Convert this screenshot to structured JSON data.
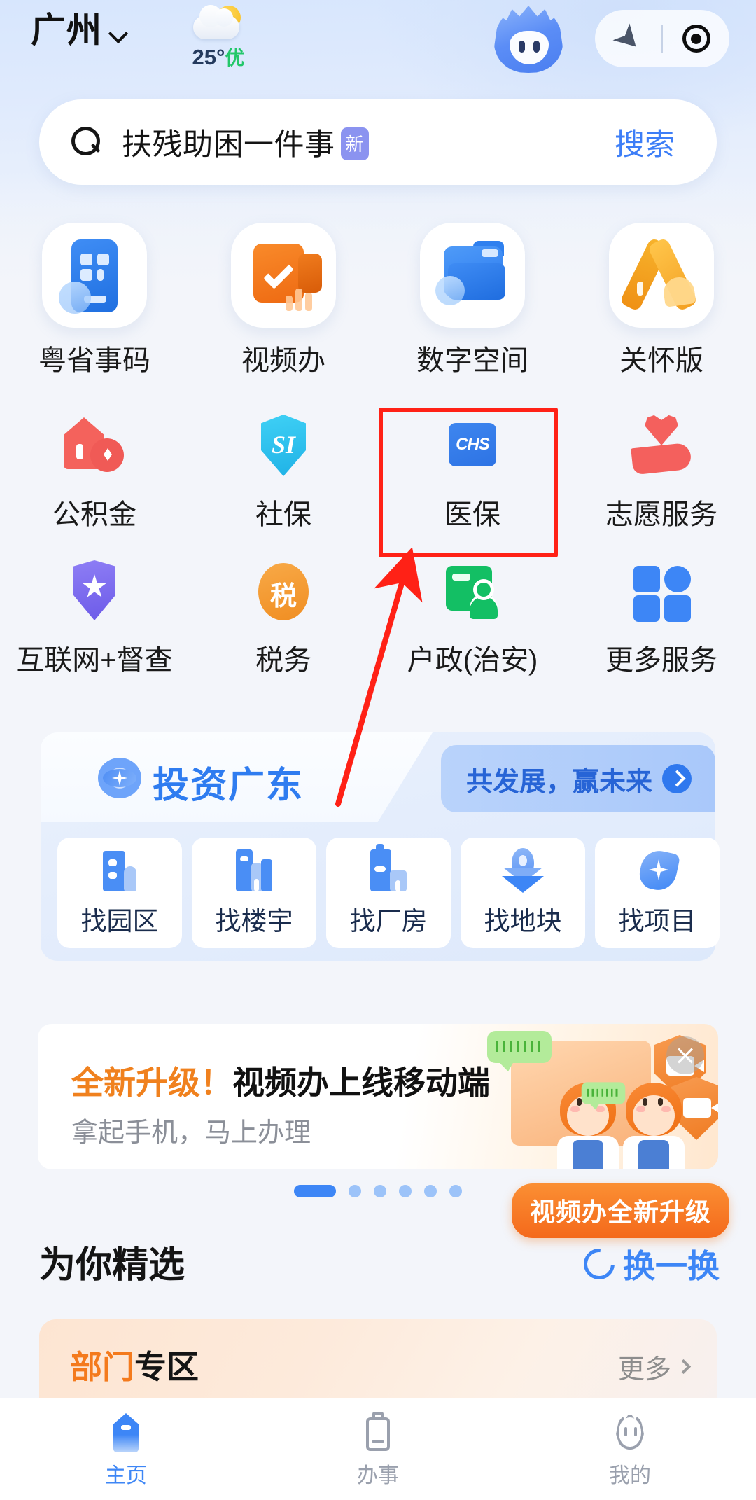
{
  "header": {
    "city": "广州",
    "city_chevron_icon": "chevron-down-icon",
    "weather_icon": "sun-behind-cloud-icon",
    "weather_temp": "25°",
    "weather_quality": "优",
    "mascot_icon": "blue-flame-mascot-icon",
    "nav_arrow_icon": "navigation-arrow-icon",
    "record_icon": "record-circle-icon"
  },
  "search": {
    "icon": "search-icon",
    "keyword": "扶残助困一件事",
    "badge": "新",
    "button": "搜索"
  },
  "grid": {
    "row1": [
      {
        "label": "粤省事码",
        "icon": "qr-card-icon"
      },
      {
        "label": "视频办",
        "icon": "video-check-icon"
      },
      {
        "label": "数字空间",
        "icon": "digital-folder-icon"
      },
      {
        "label": "关怀版",
        "icon": "care-ribbon-icon"
      }
    ],
    "row2": [
      {
        "label": "公积金",
        "icon": "housing-fund-icon"
      },
      {
        "label": "社保",
        "icon": "social-insurance-shield-icon",
        "icon_text": "SI"
      },
      {
        "label": "医保",
        "icon": "medical-insurance-chs-icon",
        "icon_text": "CHS",
        "highlighted": true
      },
      {
        "label": "志愿服务",
        "icon": "volunteer-heart-hand-icon"
      }
    ],
    "row3": [
      {
        "label": "互联网+督查",
        "icon": "shield-star-icon"
      },
      {
        "label": "税务",
        "icon": "tax-circle-icon",
        "icon_text": "税"
      },
      {
        "label": "户政(治安)",
        "icon": "household-id-card-icon"
      },
      {
        "label": "更多服务",
        "icon": "more-grid-icon"
      }
    ]
  },
  "invest": {
    "logo_icon": "invest-guangdong-logo-icon",
    "title": "投资广东",
    "tag_text": "共发展，赢未来",
    "tag_chevron_icon": "chevron-right-circle-icon",
    "items": [
      {
        "label": "找园区",
        "icon": "park-building-icon"
      },
      {
        "label": "找楼宇",
        "icon": "office-tower-icon"
      },
      {
        "label": "找厂房",
        "icon": "factory-icon"
      },
      {
        "label": "找地块",
        "icon": "land-pin-icon"
      },
      {
        "label": "找项目",
        "icon": "project-star-icon"
      }
    ]
  },
  "banner": {
    "title_highlight": "全新升级！",
    "title_rest": "视频办上线移动端",
    "subtitle": "拿起手机，马上办理",
    "close_icon": "close-icon",
    "float_badge": "视频办全新升级",
    "dots_total": 6,
    "dots_active_index": 0
  },
  "section": {
    "title": "为你精选",
    "refresh_icon": "refresh-icon",
    "refresh_label": "换一换"
  },
  "dept": {
    "title_highlight": "部门",
    "title_rest": "专区",
    "more_label": "更多",
    "more_chevron_icon": "chevron-right-icon"
  },
  "tabbar": [
    {
      "label": "主页",
      "icon": "home-icon",
      "active": true
    },
    {
      "label": "办事",
      "icon": "clipboard-icon",
      "active": false
    },
    {
      "label": "我的",
      "icon": "mascot-head-icon",
      "active": false
    }
  ],
  "annotation": {
    "box_target": "医保",
    "box_color": "#ff2116",
    "arrow_color": "#ff2116"
  },
  "colors": {
    "accent_blue": "#3d86f6",
    "accent_orange": "#f47a1c",
    "green": "#23c76a",
    "header_gradient_top": "#d7e6fd",
    "page_bg": "#f3f5fa"
  }
}
